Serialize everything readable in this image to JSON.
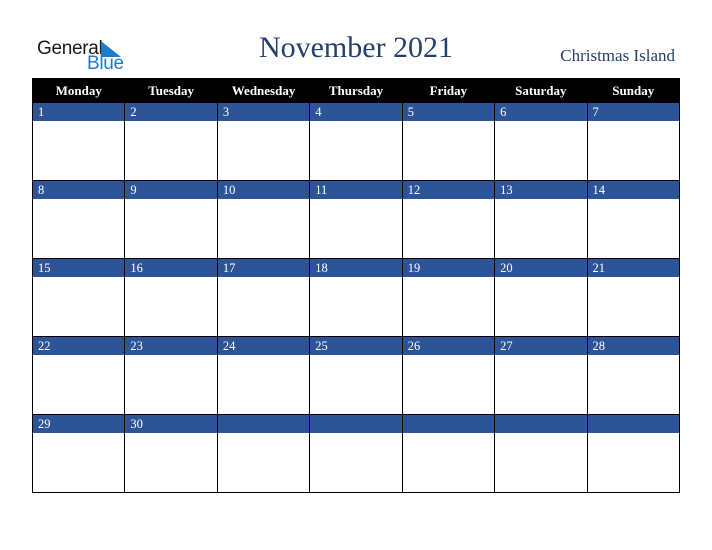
{
  "logo": {
    "line1": "General",
    "line2": "Blue",
    "icon": "triangle-flag-icon",
    "color": "#1f7dc6"
  },
  "header": {
    "title": "November 2021",
    "region": "Christmas Island"
  },
  "calendar": {
    "weekdays": [
      "Monday",
      "Tuesday",
      "Wednesday",
      "Thursday",
      "Friday",
      "Saturday",
      "Sunday"
    ],
    "weeks": [
      [
        "1",
        "2",
        "3",
        "4",
        "5",
        "6",
        "7"
      ],
      [
        "8",
        "9",
        "10",
        "11",
        "12",
        "13",
        "14"
      ],
      [
        "15",
        "16",
        "17",
        "18",
        "19",
        "20",
        "21"
      ],
      [
        "22",
        "23",
        "24",
        "25",
        "26",
        "27",
        "28"
      ],
      [
        "29",
        "30",
        "",
        "",
        "",
        "",
        ""
      ]
    ],
    "colors": {
      "header_bg": "#000000",
      "date_strip": "#2d5496",
      "title": "#27406b"
    }
  }
}
